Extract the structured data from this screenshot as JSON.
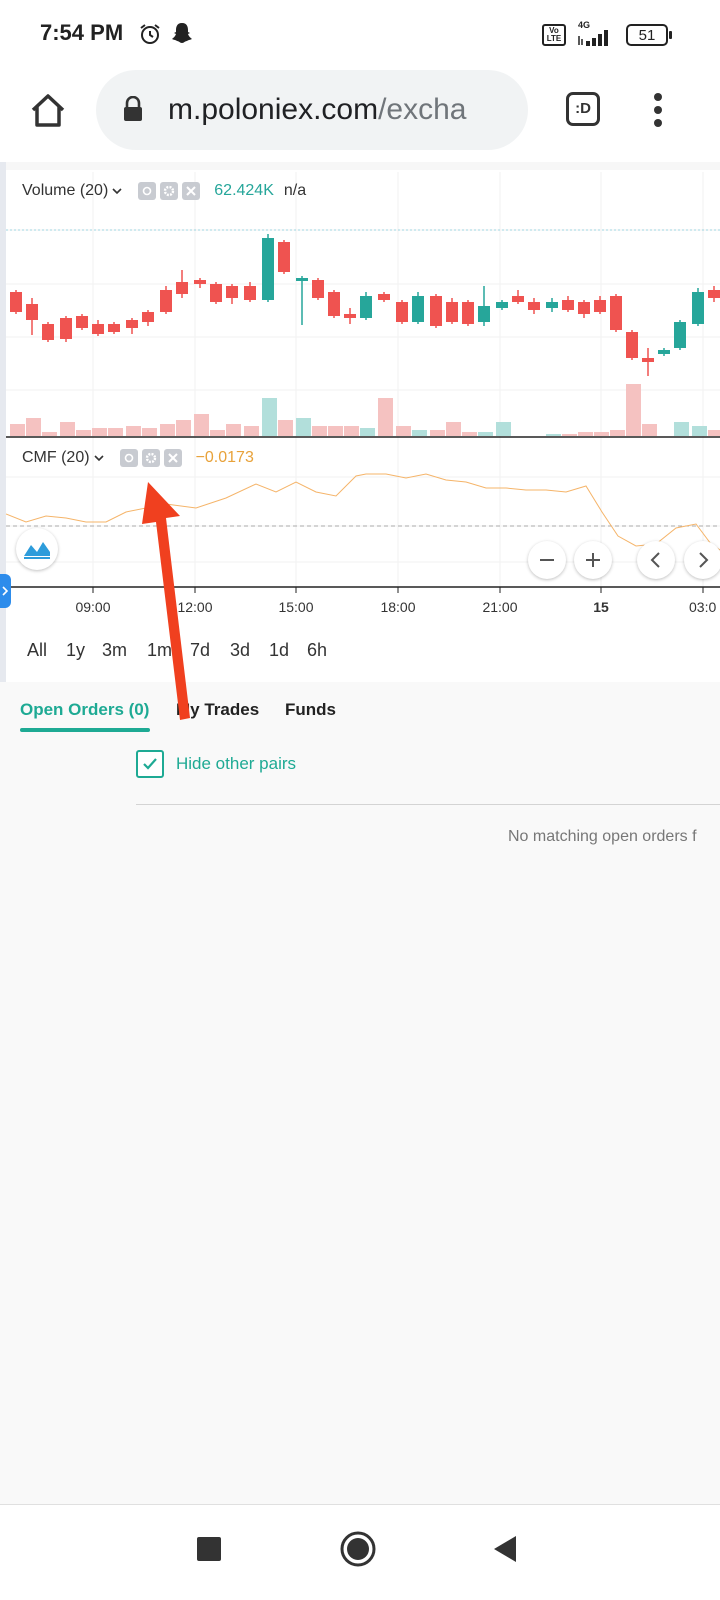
{
  "status": {
    "time": "7:54 PM",
    "network_badge": "Vo\nLTE",
    "network_type": "4G",
    "battery": "51"
  },
  "browser": {
    "url_domain": "m.poloniex.com",
    "url_path": "/excha",
    "tab_label": ":D"
  },
  "chart": {
    "volume_indicator": {
      "name": "Volume (20)",
      "value": "62.424K",
      "value2": "n/a"
    },
    "cmf_indicator": {
      "name": "CMF (20)",
      "value": "−0.0173"
    },
    "time_labels": [
      "09:00",
      "12:00",
      "15:00",
      "18:00",
      "21:00",
      "15",
      "03:0"
    ],
    "colors": {
      "up": "#26a69a",
      "down": "#ef5350",
      "cmf_line": "#f5b469",
      "accent": "#1eaa94"
    }
  },
  "ranges": [
    "All",
    "1y",
    "3m",
    "1m",
    "7d",
    "3d",
    "1d",
    "6h"
  ],
  "tabs": [
    "Open Orders (0)",
    "My Trades",
    "Funds"
  ],
  "orders": {
    "hide_pairs_label": "Hide other pairs",
    "hide_pairs_checked": true,
    "empty_message": "No matching open orders f"
  }
}
